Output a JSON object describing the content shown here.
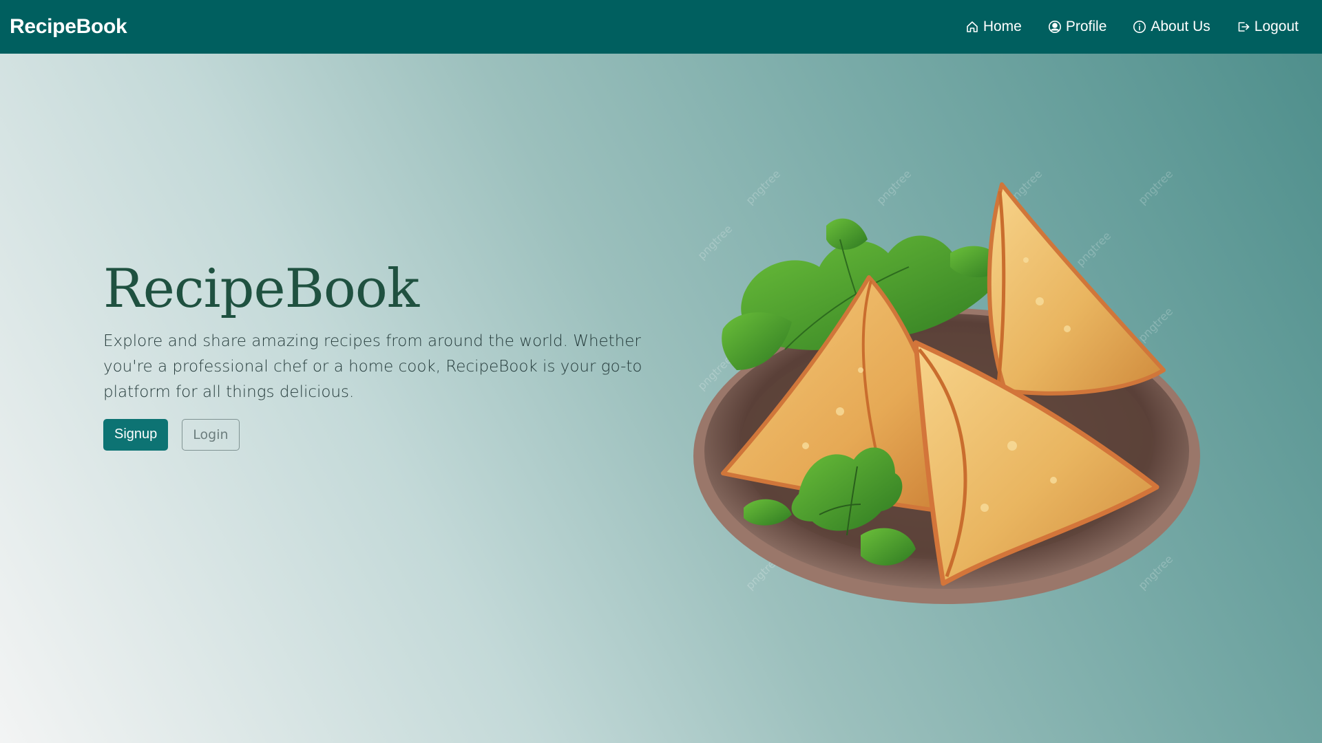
{
  "navbar": {
    "brand": "RecipeBook",
    "links": [
      {
        "label": "Home",
        "icon": "home-icon"
      },
      {
        "label": "Profile",
        "icon": "user-circle-icon"
      },
      {
        "label": "About Us",
        "icon": "info-icon"
      },
      {
        "label": "Logout",
        "icon": "logout-icon"
      }
    ]
  },
  "hero": {
    "title": "RecipeBook",
    "description": "Explore and share amazing recipes from around the world. Whether you're a professional chef or a home cook, RecipeBook is your go-to platform for all things delicious.",
    "signup_label": "Signup",
    "login_label": "Login",
    "image_subject": "samosas on a plate with parsley",
    "watermark_text": "pngtree"
  },
  "colors": {
    "navbar_bg": "#005f5f",
    "title": "#1f5140",
    "primary_button": "#0d7373"
  }
}
